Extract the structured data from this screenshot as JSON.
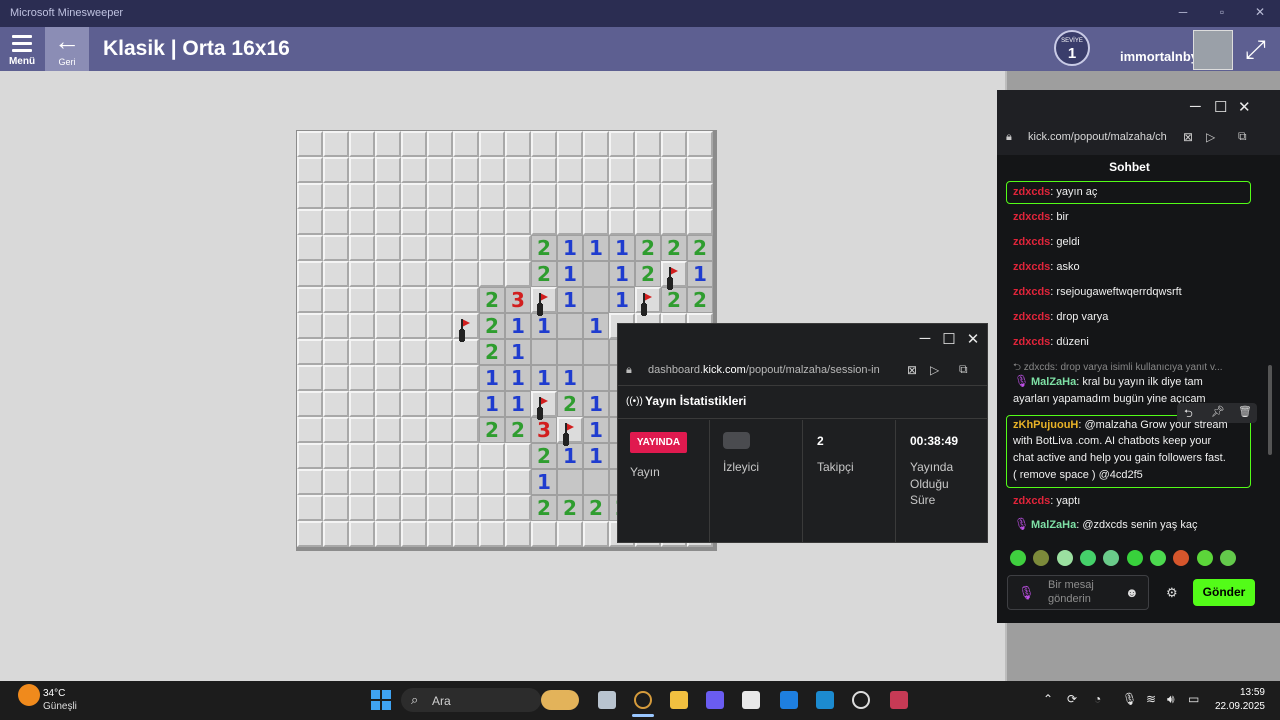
{
  "window": {
    "title": "Microsoft Minesweeper"
  },
  "appbar": {
    "menu_label": "Menü",
    "back_label": "Geri",
    "game_title": "Klasik | Orta 16x16",
    "level_label": "SEVİYE",
    "level_value": "1",
    "username": "immortalnby"
  },
  "board": {
    "size": 16,
    "rows": [
      "UUUUUUUUUUUUUUUU",
      "UUUUUUUUUUUUUUUU",
      "UUUUUUUUUUUUUUUU",
      "UUUUUUUUUUUUUUUU",
      "UUUUUUUUU2111222",
      "UUUUUUUUU21.12F1",
      "UUUUUUU23F1.1F22",
      "UUUUUUF211.1UUUU",
      "UUUUUUU21.......",
      "UUUUUUU1111.....",
      "UUUUUUU11F21....",
      "UUUUUUU223F1....",
      "UUUUUUUUU211....",
      "UUUUUUUUU1......",
      "UUUUUUUUU2222...",
      "UUUUUUUUUUUUUUUU"
    ]
  },
  "stats_popup": {
    "url_prefix": "dashboard.",
    "url_domain": "kick.com",
    "url_rest": "/popout/malzaha/session-in",
    "heading": "Yayın İstatistikleri",
    "live_badge": "YAYINDA",
    "live_label": "Yayın",
    "viewers_label": "İzleyici",
    "followers_value": "2",
    "followers_label": "Takipçi",
    "uptime_value": "00:38:49",
    "uptime_label_1": "Yayında",
    "uptime_label_2": "Olduğu",
    "uptime_label_3": "Süre"
  },
  "chat_popup": {
    "url": "kick.com/popout/malzaha/ch",
    "title": "Sohbet",
    "messages": [
      {
        "user": "zdxcds",
        "text": ": yayın aç"
      },
      {
        "user": "zdxcds",
        "text": ": bir"
      },
      {
        "user": "zdxcds",
        "text": ": geldi"
      },
      {
        "user": "zdxcds",
        "text": ": asko"
      },
      {
        "user": "zdxcds",
        "text": ": rsejougaweftwqerrdqwsrft"
      },
      {
        "user": "zdxcds",
        "text": ": drop varya"
      },
      {
        "user": "zdxcds",
        "text": ": düzeni"
      }
    ],
    "reply_context": "zdxcds: drop varya isimli kullanıcıya yanıt v...",
    "malzaha_1_user": "MalZaHa",
    "malzaha_1_text_1": ": kral bu yayın ilk diye tam",
    "malzaha_1_text_2": "ayarları yapamadım bugün yine açıcam",
    "spam_user": "zKhPujuouH",
    "spam_text_1": ": @malzaha Grow your stream",
    "spam_text_2": "with BotLiva .com. AI chatbots keep your",
    "spam_text_3": "chat active and help you gain followers fast.",
    "spam_text_4": "( remove space ) @4cd2f5",
    "after_user": "zdxcds",
    "after_text": ": yaptı",
    "malzaha_2_user": "MalZaHa",
    "malzaha_2_text": ": @zdxcds senin yaş kaç",
    "input_placeholder_1": "Bir mesaj",
    "input_placeholder_2": "gönderin",
    "send_label": "Gönder",
    "colors": {
      "accent": "#53fc18",
      "user_red": "#e0243a",
      "user_green": "#7ee0a5"
    }
  },
  "taskbar": {
    "temperature": "34°C",
    "condition": "Güneşli",
    "search_label": "Ara",
    "time": "13:59",
    "date": "22.09.2025"
  }
}
